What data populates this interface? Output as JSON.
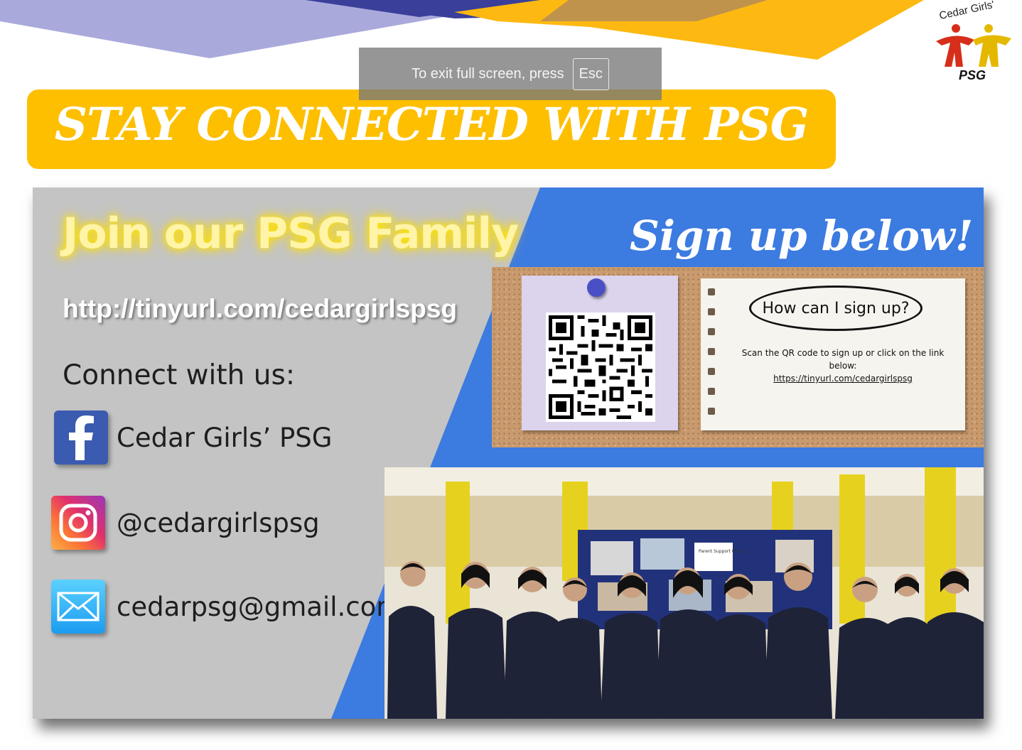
{
  "toast": {
    "text": "To exit full screen, press",
    "key": "Esc"
  },
  "logo": {
    "top_text": "Cedar Girls'",
    "bottom_text": "PSG"
  },
  "banner": {
    "title": "STAY CONNECTED WITH PSG"
  },
  "left_panel": {
    "join_title": "Join our PSG Family",
    "url": "http://tinyurl.com/cedargirlspsg",
    "connect_title": "Connect with us:",
    "socials": [
      {
        "icon": "facebook-icon",
        "label": "Cedar Girls’ PSG"
      },
      {
        "icon": "instagram-icon",
        "label": "@cedargirlspsg"
      },
      {
        "icon": "email-icon",
        "label": "cedarpsg@gmail.com"
      }
    ]
  },
  "right_panel": {
    "signup_title": "Sign up below!",
    "note": {
      "heading": "How can I sign up?",
      "instruction": "Scan the QR code to sign up or click on the link below:",
      "link": "https://tinyurl.com/cedargirlspsg"
    },
    "photo": {
      "board_label": "Parent Support Group"
    }
  },
  "colors": {
    "banner_yellow": "#fdbf00",
    "card_blue": "#3c7be0",
    "panel_grey": "#c4c4c4",
    "deco_purple": "#a9aadb",
    "deco_navy": "#3a3f9a",
    "deco_brown": "#b08a5b",
    "deco_yellow": "#fdb911"
  }
}
